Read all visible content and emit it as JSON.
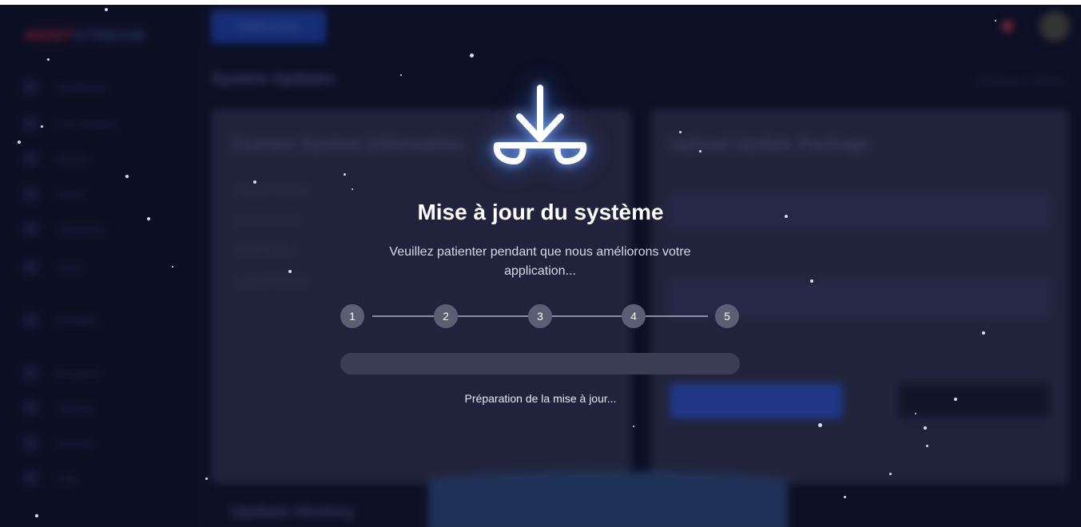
{
  "background_app": {
    "brand_part1": "HOST",
    "brand_part2": "STREAM",
    "topbar_button": "Switch to Live",
    "page_title": "System Updates",
    "breadcrumb": "Dashboard / Updates",
    "sidebar_items": [
      "Dashboard",
      "Live Streams",
      "Movies",
      "Series",
      "Categories",
      "Users",
      "Resellers",
      "Bouquets",
      "Settings",
      "Security",
      "Logs"
    ],
    "card_left_title": "Current System Information",
    "card_left_rows": [
      "Current Version",
      "Last Updated",
      "PHP Version",
      "Laravel Version"
    ],
    "card_right_title": "Upload Update Package",
    "section_title": "Update History"
  },
  "update_modal": {
    "icon": "download-arrow-icon",
    "title": "Mise à jour du système",
    "subtitle": "Veuillez patienter pendant que nous améliorons votre application...",
    "steps": [
      "1",
      "2",
      "3",
      "4",
      "5"
    ],
    "progress_fraction": 0.0,
    "status": "Préparation de la mise à jour..."
  },
  "colors": {
    "background": "#0b0d22",
    "accent": "#6f86ff",
    "step_circle": "#5b5e74",
    "icon_glow": "#78aaff"
  }
}
